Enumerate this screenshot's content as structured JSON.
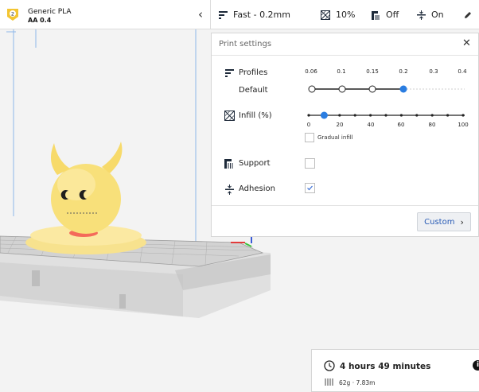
{
  "material_selector": {
    "extruder_number": "2",
    "material_name": "Generic PLA",
    "core_name": "AA 0.4",
    "collapse_icon": "chevron-left-icon"
  },
  "settings_bar": {
    "profile": "Fast - 0.2mm",
    "infill": "10%",
    "support": "Off",
    "adhesion": "On",
    "edit_icon": "pencil-icon"
  },
  "print_settings": {
    "title": "Print settings",
    "profiles_label": "Profiles",
    "default_label": "Default",
    "layer_height_ticks": [
      "0.06",
      "0.1",
      "0.15",
      "0.2",
      "0.3",
      "0.4"
    ],
    "layer_height_selected": "0.2",
    "infill_label": "Infill (%)",
    "infill_ticks": [
      "0",
      "20",
      "40",
      "60",
      "80",
      "100"
    ],
    "infill_value": 10,
    "gradual_infill_label": "Gradual infill",
    "gradual_infill_checked": false,
    "support_label": "Support",
    "support_checked": false,
    "adhesion_label": "Adhesion",
    "adhesion_checked": true,
    "custom_button": "Custom",
    "accent_color": "#2a7de1"
  },
  "estimate": {
    "print_time": "4 hours 49 minutes",
    "material_usage": "62g · 7.83m",
    "info_icon": "i"
  }
}
